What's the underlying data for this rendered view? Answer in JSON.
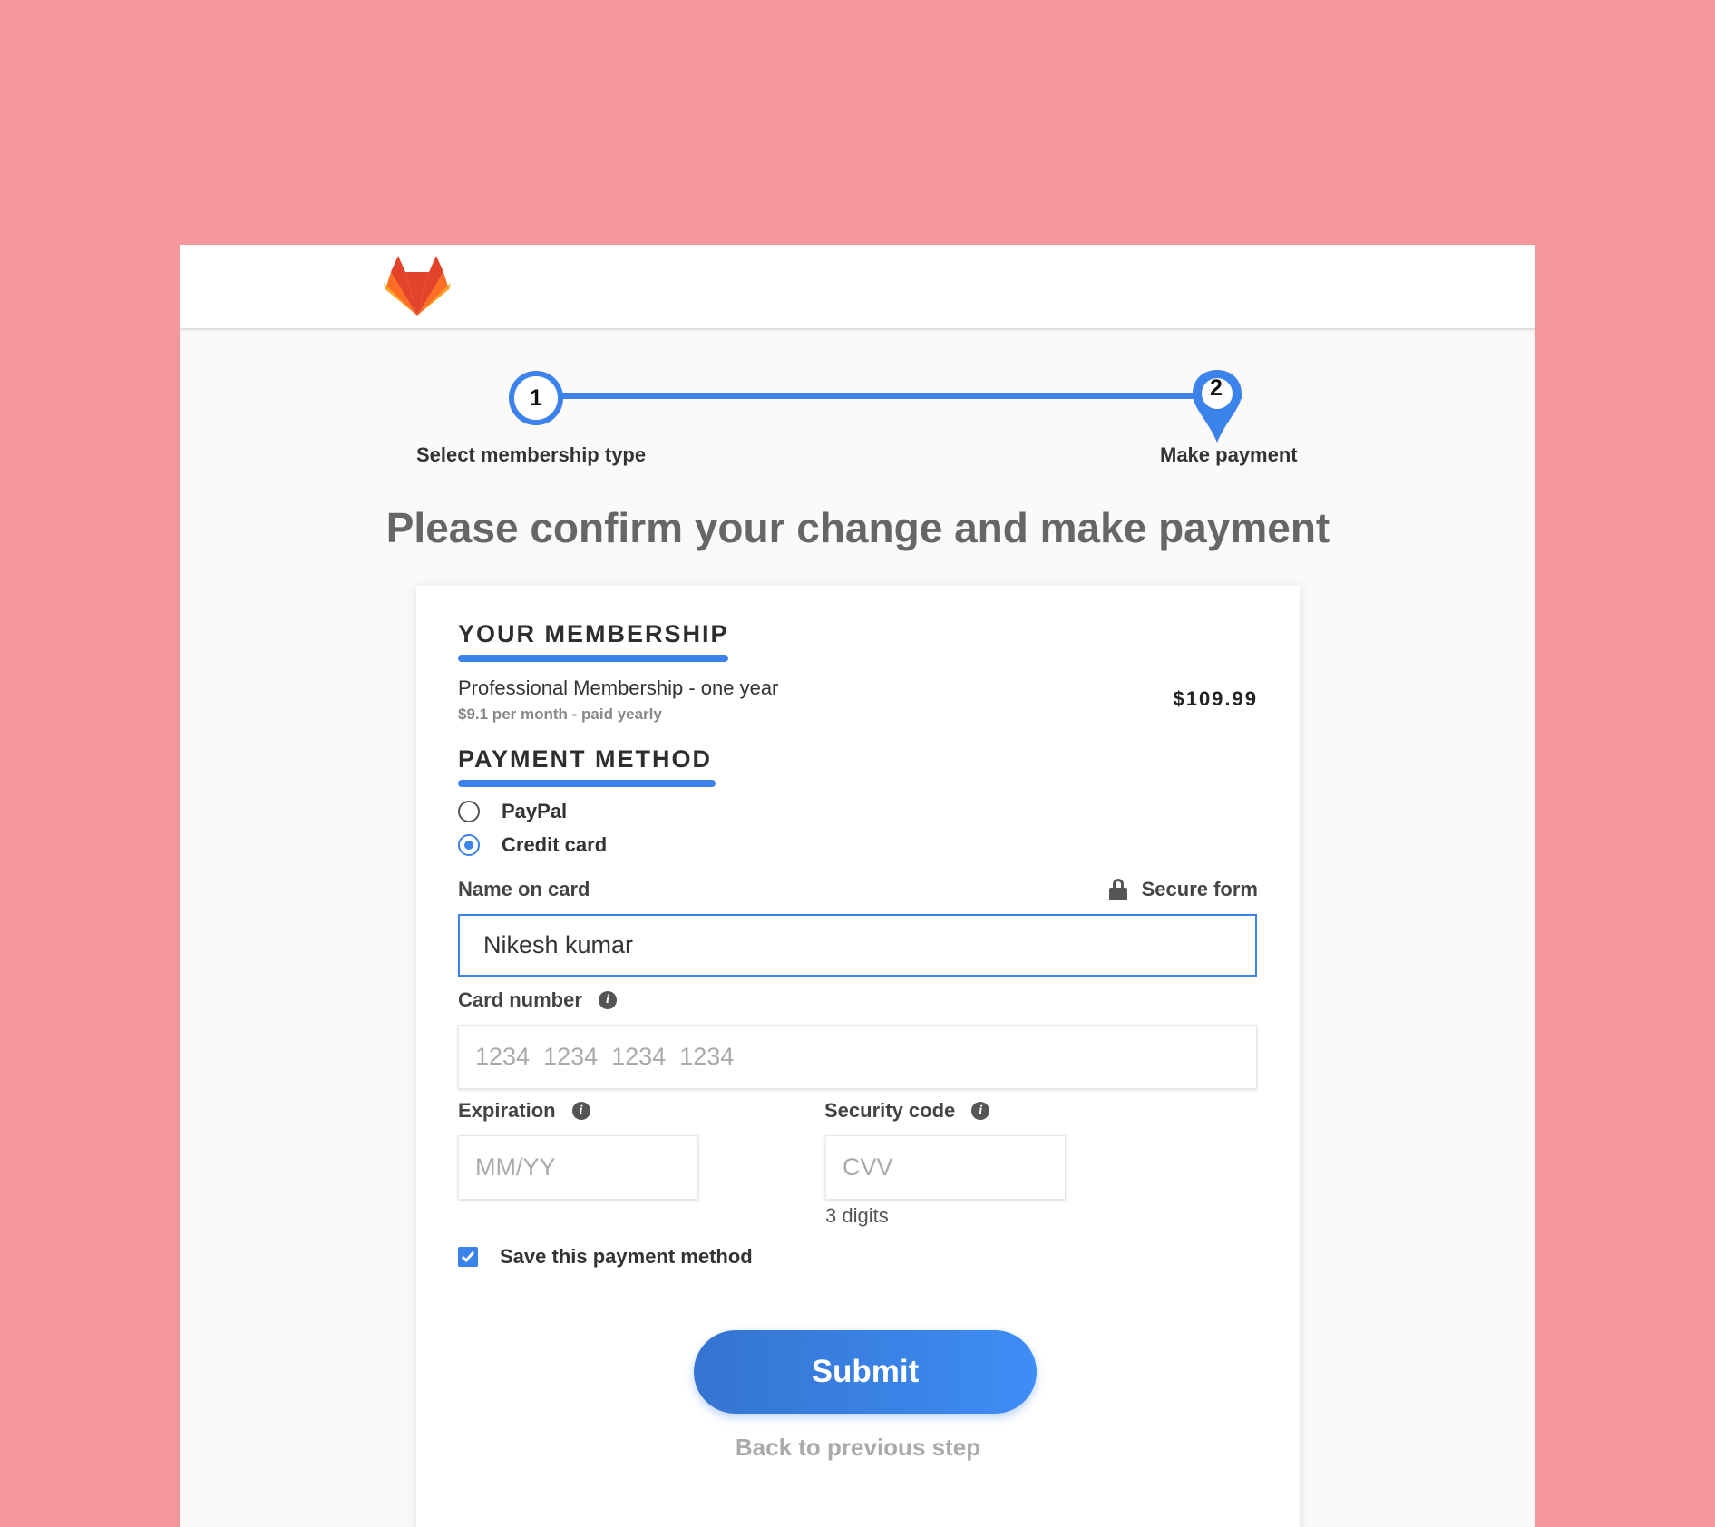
{
  "stepper": {
    "step1_number": "1",
    "step1_label": "Select membership type",
    "step2_number": "2",
    "step2_label": "Make payment"
  },
  "page_title": "Please confirm your change and make payment",
  "membership": {
    "heading": "YOUR MEMBERSHIP",
    "plan_name": "Professional Membership - one year",
    "plan_detail": "$9.1 per month - paid yearly",
    "price": "$109.99"
  },
  "payment": {
    "heading": "PAYMENT METHOD",
    "options": [
      {
        "label": "PayPal",
        "selected": false
      },
      {
        "label": "Credit card",
        "selected": true
      }
    ],
    "secure_label": "Secure form",
    "name_label": "Name on card",
    "name_value": "Nikesh kumar",
    "card_label": "Card number",
    "card_placeholder": "1234  1234  1234  1234",
    "expiration_label": "Expiration",
    "expiration_placeholder": "MM/YY",
    "security_label": "Security code",
    "security_placeholder": "CVV",
    "security_hint": "3 digits",
    "save_label": "Save this payment method",
    "save_checked": true
  },
  "actions": {
    "submit_label": "Submit",
    "back_label": "Back to previous step"
  },
  "icons": {
    "logo": "gitlab-fox-logo",
    "info": "info-icon",
    "lock": "lock-icon",
    "check": "checkmark-icon"
  },
  "colors": {
    "page_background": "#f3979b",
    "accent": "#3b82ea",
    "logo_orange": "#e24329",
    "logo_light": "#fca326"
  }
}
